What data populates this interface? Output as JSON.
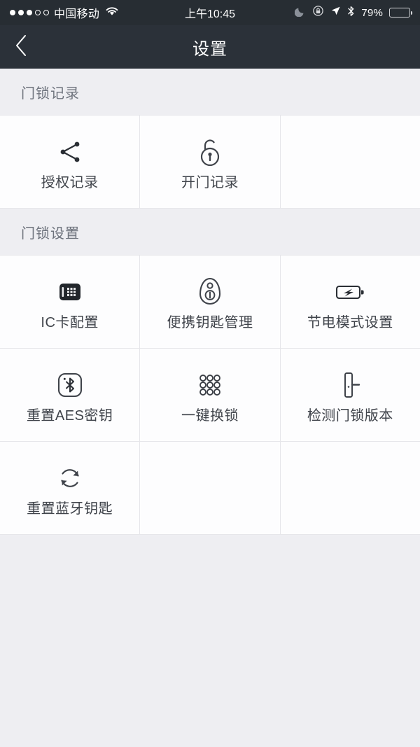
{
  "status_bar": {
    "carrier": "中国移动",
    "signal_dots_filled": 3,
    "signal_dots_total": 5,
    "wifi_icon": "wifi-icon",
    "time": "上午10:45",
    "icons": [
      "moon-icon",
      "rotation-lock-icon",
      "location-arrow-icon",
      "bluetooth-icon"
    ],
    "battery_percent": "79%",
    "battery_level": 79,
    "background_color": "#272d33"
  },
  "nav_bar": {
    "back_icon": "chevron-left-icon",
    "title": "设置",
    "background_color": "#2b3139"
  },
  "sections": [
    {
      "header": "门锁记录",
      "items": [
        {
          "label": "授权记录",
          "icon": "share-icon",
          "empty": false
        },
        {
          "label": "开门记录",
          "icon": "unlocked-padlock-icon",
          "empty": false
        },
        {
          "label": "",
          "icon": "",
          "empty": true
        }
      ]
    },
    {
      "header": "门锁设置",
      "items": [
        {
          "label": "IC卡配置",
          "icon": "ic-card-icon",
          "empty": false
        },
        {
          "label": "便携钥匙管理",
          "icon": "key-fob-icon",
          "empty": false
        },
        {
          "label": "节电模式设置",
          "icon": "battery-bolt-icon",
          "empty": false
        },
        {
          "label": "重置蓝牙钥匙",
          "icon": "bluetooth-square-icon",
          "empty": false
        },
        {
          "label": "重置AES密钥",
          "icon": "keypad-grid-icon",
          "empty": false
        },
        {
          "label": "一键换锁",
          "icon": "door-handle-icon",
          "empty": false
        },
        {
          "label": "检测门锁版本",
          "icon": "refresh-icon",
          "empty": false
        },
        {
          "label": "",
          "icon": "",
          "empty": true
        },
        {
          "label": "",
          "icon": "",
          "empty": true
        }
      ]
    }
  ],
  "colors": {
    "page_background": "#eeeef2",
    "cell_background": "#fdfdfe",
    "grid_line": "#e6e6ea",
    "label_text": "#3f434a",
    "header_text": "#6d727c",
    "icon_stroke": "#3f434a"
  }
}
